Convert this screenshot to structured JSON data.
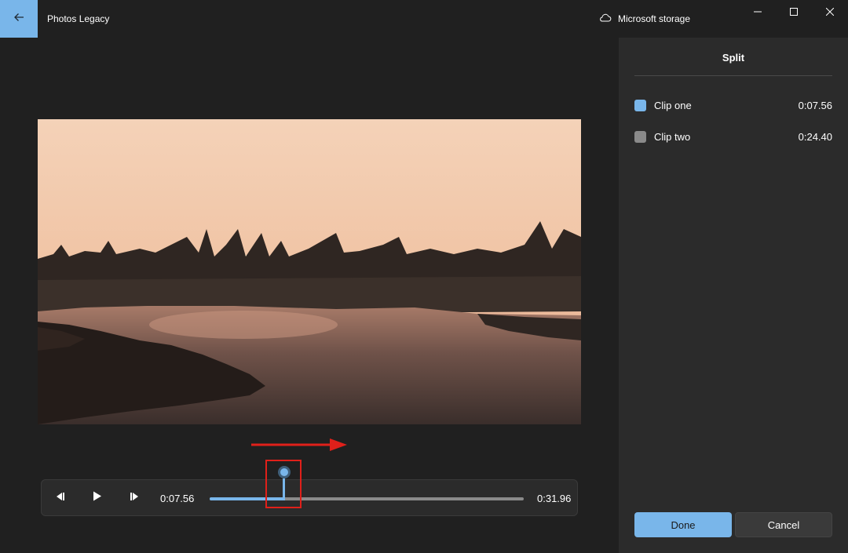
{
  "titlebar": {
    "app_title": "Photos Legacy",
    "storage_label": "Microsoft storage",
    "icons": {
      "back": "back-arrow-icon",
      "storage": "cloud-icon",
      "minimize": "minimize-icon",
      "maximize": "maximize-icon",
      "close": "close-icon"
    }
  },
  "player": {
    "current_time": "0:07.56",
    "total_time": "0:31.96",
    "progress_fraction": 0.2365,
    "icons": {
      "prev_frame": "previous-frame-icon",
      "play": "play-icon",
      "next_frame": "next-frame-icon"
    }
  },
  "panel": {
    "title": "Split",
    "clips": [
      {
        "name": "Clip one",
        "duration": "0:07.56",
        "color": "#79b6ea"
      },
      {
        "name": "Clip two",
        "duration": "0:24.40",
        "color": "#8a8a8a"
      }
    ],
    "done_label": "Done",
    "cancel_label": "Cancel"
  },
  "colors": {
    "accent": "#79b6ea",
    "annotation": "#e0201a",
    "background": "#202020",
    "panel": "#2b2b2b"
  }
}
